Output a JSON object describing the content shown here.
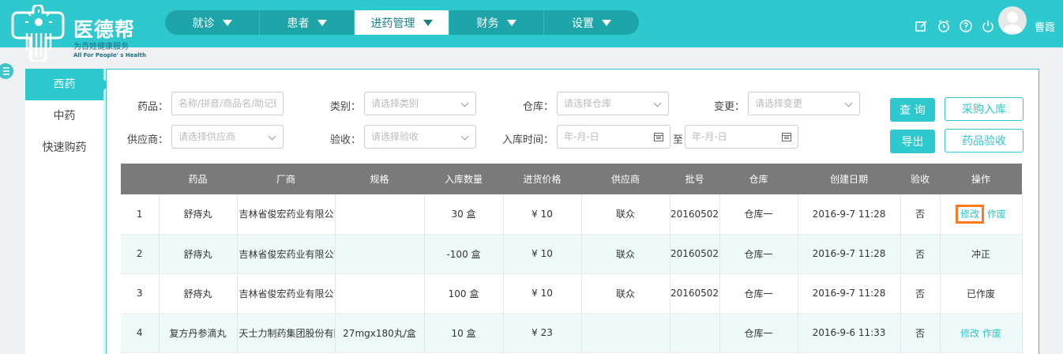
{
  "brand": {
    "name": "医德帮",
    "slogan": "为百姓健康服务",
    "slogan_en": "All For People' s Health"
  },
  "nav": {
    "items": [
      {
        "label": "就诊"
      },
      {
        "label": "患者"
      },
      {
        "label": "进药管理"
      },
      {
        "label": "财务"
      },
      {
        "label": "设置"
      }
    ],
    "active_index": 2
  },
  "header": {
    "icons": [
      "edit-icon",
      "alarm-icon",
      "help-icon",
      "power-icon"
    ],
    "username": "曹霞"
  },
  "sidebar": {
    "items": [
      {
        "label": "西药"
      },
      {
        "label": "中药"
      },
      {
        "label": "快速购药"
      }
    ],
    "active_index": 0
  },
  "filters": {
    "drug_label": "药品：",
    "drug_placeholder": "名称/拼音/商品名/助记码",
    "category_label": "类别：",
    "category_placeholder": "请选择类别",
    "warehouse_label": "仓库：",
    "warehouse_placeholder": "请选择仓库",
    "change_label": "变更：",
    "change_placeholder": "请选择变更",
    "supplier_label": "供应商：",
    "supplier_placeholder": "请选择供应商",
    "check_label": "验收：",
    "check_placeholder": "请选择验收",
    "time_label": "入库时间：",
    "date_from_placeholder": "年-月-日",
    "date_to_label": "至",
    "date_to_placeholder": "年-月-日"
  },
  "buttons": {
    "query": "查 询",
    "purchase_in": "采购入库",
    "export": "导出",
    "drug_check": "药品验收"
  },
  "table": {
    "columns": [
      "",
      "药品",
      "厂商",
      "规格",
      "入库数量",
      "进货价格",
      "供应商",
      "批号",
      "仓库",
      "创建日期",
      "验收",
      "操作"
    ],
    "rows": [
      {
        "no": "1",
        "drug": "舒痔丸",
        "maker": "吉林省俊宏药业有限公司",
        "spec": "",
        "qty": "30 盒",
        "price": "¥ 10",
        "supplier": "联众",
        "batch": "20160502",
        "warehouse": "仓库一",
        "date": "2016-9-7 11:28",
        "check": "否",
        "ops": [
          "修改",
          "作废"
        ],
        "status": ""
      },
      {
        "no": "2",
        "drug": "舒痔丸",
        "maker": "吉林省俊宏药业有限公司",
        "spec": "",
        "qty": "-100 盒",
        "price": "¥ 10",
        "supplier": "联众",
        "batch": "20160502",
        "warehouse": "仓库一",
        "date": "2016-9-7 11:28",
        "check": "否",
        "ops": [],
        "status": "冲正"
      },
      {
        "no": "3",
        "drug": "舒痔丸",
        "maker": "吉林省俊宏药业有限公司",
        "spec": "",
        "qty": "100 盒",
        "price": "¥ 10",
        "supplier": "联众",
        "batch": "20160502",
        "warehouse": "仓库一",
        "date": "2016-9-7 11:28",
        "check": "否",
        "ops": [],
        "status": "已作废"
      },
      {
        "no": "4",
        "drug": "复方丹参滴丸",
        "maker": "天士力制药集团股份有限公司",
        "spec": "27mgx180丸/盒",
        "qty": "10 盒",
        "price": "¥ 23",
        "supplier": "",
        "batch": "",
        "warehouse": "仓库一",
        "date": "2016-9-6 11:33",
        "check": "否",
        "ops": [
          "修改",
          "作废"
        ],
        "status": ""
      }
    ]
  },
  "colors": {
    "accent": "#2ec8cf",
    "nav_dark": "#1da5aa",
    "table_header": "#7a7a7a",
    "highlight": "#ff7a1a"
  }
}
